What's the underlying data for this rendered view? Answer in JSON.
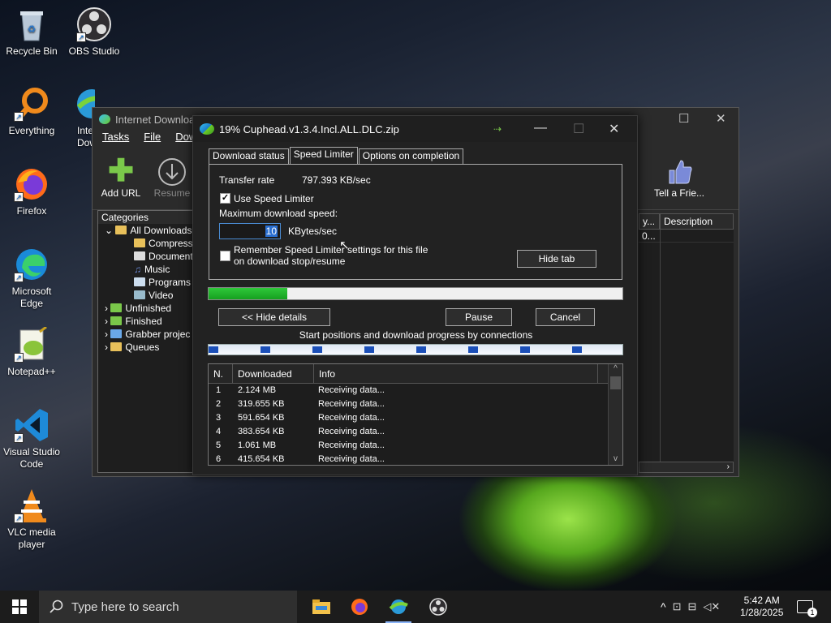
{
  "desktop": {
    "icons": [
      {
        "label": "Recycle Bin"
      },
      {
        "label": "OBS Studio"
      },
      {
        "label": "Everything"
      },
      {
        "label": "Inte Dow"
      },
      {
        "label": "Firefox"
      },
      {
        "label": "Microsoft Edge"
      },
      {
        "label": "Notepad++"
      },
      {
        "label": "Visual Studio Code"
      },
      {
        "label": "VLC media player"
      }
    ]
  },
  "idm_main": {
    "title": "Internet Downloa",
    "menu": [
      "Tasks",
      "File",
      "Dow"
    ],
    "toolbar": {
      "add_url": "Add URL",
      "resume": "Resume",
      "tell_friend": "Tell a Frie..."
    },
    "categories": {
      "header": "Categories",
      "items": [
        "All Downloads",
        "Compresse",
        "Documents",
        "Music",
        "Programs",
        "Video",
        "Unfinished",
        "Finished",
        "Grabber projec",
        "Queues"
      ]
    },
    "columns": {
      "partial": "y...",
      "description": "Description"
    },
    "first_row_partial": "0..."
  },
  "dialog": {
    "title": "19% Cuphead.v1.3.4.Incl.ALL.DLC.zip",
    "tabs": [
      "Download status",
      "Speed Limiter",
      "Options on completion"
    ],
    "active_tab": "Speed Limiter",
    "transfer_rate_label": "Transfer rate",
    "transfer_rate_value": "797.393  KB/sec",
    "use_limiter_label": "Use Speed Limiter",
    "use_limiter_checked": true,
    "max_speed_label": "Maximum download speed:",
    "max_speed_value": "10",
    "speed_unit": "KBytes/sec",
    "remember_line1": "Remember Speed Limiter settings for this file",
    "remember_line2": "on download stop/resume",
    "remember_checked": false,
    "hide_tab": "Hide tab",
    "progress": 0.19,
    "hide_details": "<< Hide details",
    "pause": "Pause",
    "cancel": "Cancel",
    "connections_caption": "Start positions and download progress by connections",
    "table": {
      "headers": [
        "N.",
        "Downloaded",
        "Info"
      ],
      "rows": [
        [
          "1",
          "2.124  MB",
          "Receiving data..."
        ],
        [
          "2",
          "319.655  KB",
          "Receiving data..."
        ],
        [
          "3",
          "591.654  KB",
          "Receiving data..."
        ],
        [
          "4",
          "383.654  KB",
          "Receiving data..."
        ],
        [
          "5",
          "1.061  MB",
          "Receiving data..."
        ],
        [
          "6",
          "415.654  KB",
          "Receiving data..."
        ]
      ]
    }
  },
  "taskbar": {
    "search_placeholder": "Type here to search",
    "time": "5:42 AM",
    "date": "1/28/2025",
    "notification_count": "1"
  },
  "colors": {
    "progress_green": "#1fb52a",
    "accent_blue": "#2a6fd0"
  }
}
